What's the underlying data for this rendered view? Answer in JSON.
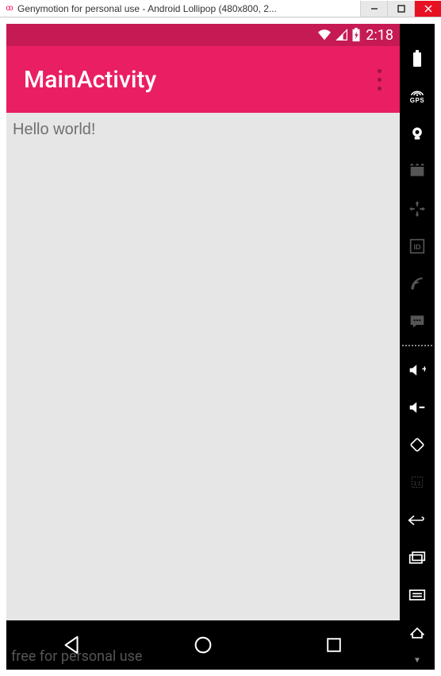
{
  "window": {
    "title": "Genymotion for personal use - Android Lollipop (480x800, 2...",
    "icon_glyph": "oo"
  },
  "statusbar": {
    "time": "2:18"
  },
  "actionbar": {
    "title": "MainActivity"
  },
  "content": {
    "body_text": "Hello world!"
  },
  "watermark": "free for personal use",
  "side_tools": {
    "gps_label": "GPS"
  },
  "colors": {
    "primary": "#e91e63",
    "primary_dark": "#c61a55"
  }
}
